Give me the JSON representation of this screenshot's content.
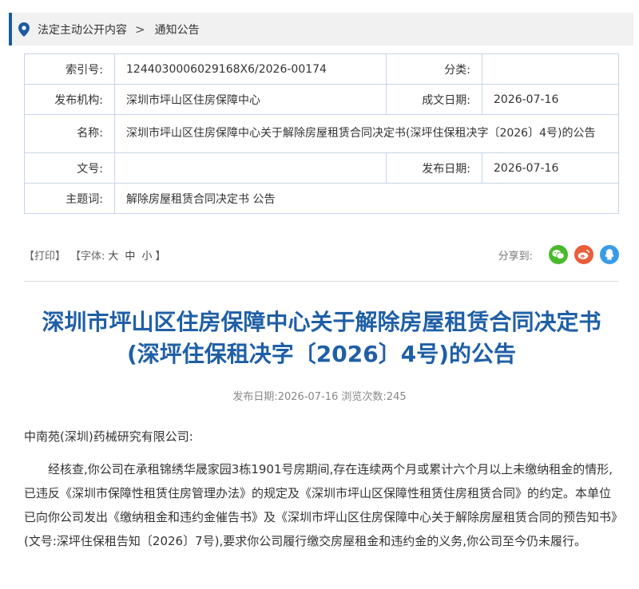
{
  "breadcrumb": {
    "items": [
      "法定主动公开内容",
      "通知公告"
    ],
    "separator": ">"
  },
  "meta": {
    "index_label": "索引号:",
    "index_value": "1244030006029168X6/2026-00174",
    "category_label": "分类:",
    "category_value": "",
    "publisher_label": "发布机构:",
    "publisher_value": "深圳市坪山区住房保障中心",
    "created_label": "成文日期:",
    "created_value": "2026-07-16",
    "name_label": "名称:",
    "name_value": "深圳市坪山区住房保障中心关于解除房屋租赁合同决定书(深坪住保租决字〔2026〕4号)的公告",
    "docno_label": "文号:",
    "docno_value": "",
    "published_label": "发布日期:",
    "published_value": "2026-07-16",
    "topic_label": "主题词:",
    "topic_value": "解除房屋租赁合同决定书 公告"
  },
  "toolbar": {
    "print": "【打印】",
    "font_prefix": "【字体:",
    "font_large": "大",
    "font_medium": "中",
    "font_small": "小",
    "font_suffix": "】",
    "share_label": "分享到:"
  },
  "article": {
    "title_line1": "深圳市坪山区住房保障中心关于解除房屋租赁合同决定书",
    "title_line2": "(深坪住保租决字〔2026〕4号)的公告",
    "pubinfo": "发布日期:2026-07-16  浏览次数:245",
    "addressee": "中南苑(深圳)药械研究有限公司:",
    "paragraph1": "经核查,你公司在承租锦绣华晟家园3栋1901号房期间,存在连续两个月或累计六个月以上未缴纳租金的情形,已违反《深圳市保障性租赁住房管理办法》的规定及《深圳市坪山区保障性租赁住房租赁合同》的约定。本单位已向你公司发出《缴纳租金和违约金催告书》及《深圳市坪山区住房保障中心关于解除房屋租赁合同的预告知书》(文号:深坪住保租告知〔2026〕7号),要求你公司履行缴交房屋租金和违约金的义务,你公司至今仍未履行。"
  },
  "icons": {
    "breadcrumb": "location-pin-icon",
    "share": [
      "wechat-icon",
      "weibo-icon",
      "qq-icon"
    ]
  },
  "colors": {
    "accent": "#1d5aa0",
    "title": "#1f5fa6",
    "table_border": "#c7d6e8"
  }
}
